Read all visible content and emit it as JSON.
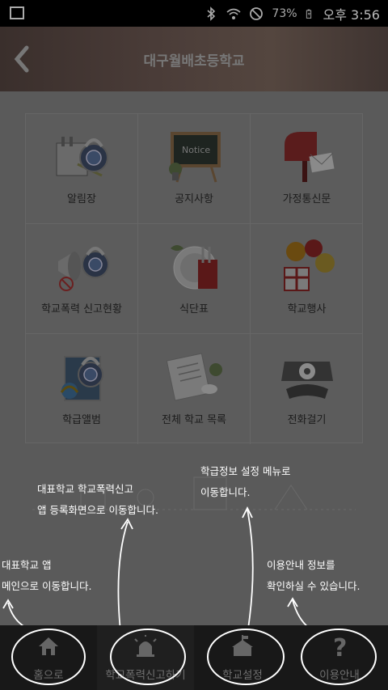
{
  "status": {
    "battery": "73%",
    "time": "오후 3:56"
  },
  "header": {
    "title": "대구월배초등학교"
  },
  "grid": [
    {
      "label": "알림장",
      "icon": "notepad-lock-icon"
    },
    {
      "label": "공지사항",
      "icon": "notice-board-icon"
    },
    {
      "label": "가정통신문",
      "icon": "mailbox-icon"
    },
    {
      "label": "학교폭력 신고현황",
      "icon": "megaphone-lock-icon"
    },
    {
      "label": "식단표",
      "icon": "plate-utensils-icon"
    },
    {
      "label": "학교행사",
      "icon": "gift-balloons-icon"
    },
    {
      "label": "학급앨범",
      "icon": "album-lock-icon"
    },
    {
      "label": "전체 학교 목록",
      "icon": "notebook-mouse-icon"
    },
    {
      "label": "전화걸기",
      "icon": "telephone-icon"
    }
  ],
  "annotations": {
    "home": [
      "대표학교 앱",
      "메인으로 이동합니다."
    ],
    "report": [
      "대표학교 학교폭력신고",
      "앱 등록화면으로 이동합니다."
    ],
    "settings": [
      "학급정보 설정 메뉴로",
      "이동합니다."
    ],
    "guide": [
      "이용안내 정보를",
      "확인하실 수 있습니다."
    ]
  },
  "tabs": [
    {
      "label": "홈으로",
      "icon": "home-icon"
    },
    {
      "label": "학교폭력신고하기",
      "icon": "siren-icon"
    },
    {
      "label": "학교설정",
      "icon": "school-icon"
    },
    {
      "label": "이용안내",
      "icon": "question-icon"
    }
  ]
}
